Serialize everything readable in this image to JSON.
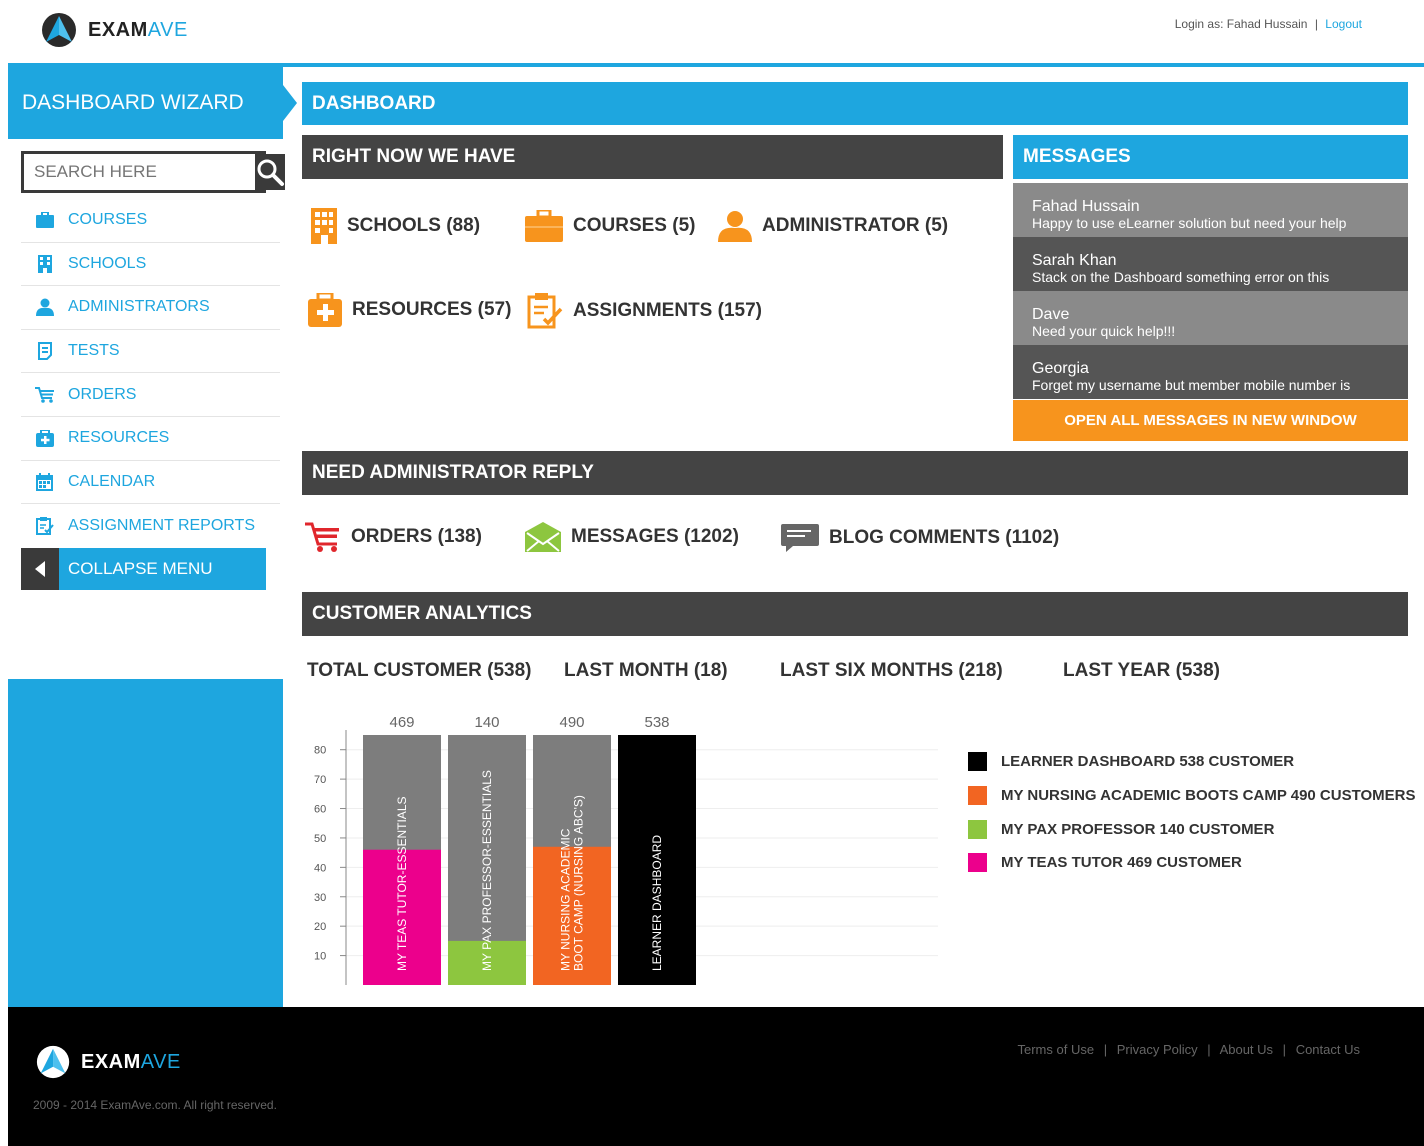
{
  "brand": {
    "name_bold": "EXAM",
    "name_light": "AVE"
  },
  "header": {
    "login_prefix": "Login as: Fahad Hussain",
    "separator": "|",
    "logout": "Logout"
  },
  "sidebar": {
    "title": "DASHBOARD WIZARD",
    "search_placeholder": "SEARCH HERE",
    "items": [
      {
        "label": "COURSES",
        "icon": "briefcase-icon"
      },
      {
        "label": "SCHOOLS",
        "icon": "building-icon"
      },
      {
        "label": "ADMINISTRATORS",
        "icon": "user-icon"
      },
      {
        "label": "TESTS",
        "icon": "document-icon"
      },
      {
        "label": "ORDERS",
        "icon": "cart-icon"
      },
      {
        "label": "RESOURCES",
        "icon": "medkit-icon"
      },
      {
        "label": "CALENDAR",
        "icon": "calendar-icon"
      },
      {
        "label": "ASSIGNMENT REPORTS",
        "icon": "clipboard-icon"
      }
    ],
    "collapse": "COLLAPSE MENU"
  },
  "dashboard": {
    "title": "DASHBOARD"
  },
  "right_now": {
    "title": "RIGHT NOW WE HAVE",
    "items": [
      {
        "label": "SCHOOLS (88)"
      },
      {
        "label": "COURSES (5)"
      },
      {
        "label": "ADMINISTRATOR (5)"
      },
      {
        "label": "RESOURCES (57)"
      },
      {
        "label": "ASSIGNMENTS (157)"
      }
    ]
  },
  "messages": {
    "title": "MESSAGES",
    "items": [
      {
        "name": "Fahad Hussain",
        "text": "Happy to use eLearner solution but need your help"
      },
      {
        "name": "Sarah Khan",
        "text": "Stack on the Dashboard something error on this"
      },
      {
        "name": "Dave",
        "text": "Need your quick help!!!"
      },
      {
        "name": "Georgia",
        "text": "Forget my username but member mobile number is"
      }
    ],
    "open_all": "OPEN ALL MESSAGES IN NEW WINDOW"
  },
  "admin_reply": {
    "title": "NEED ADMINISTRATOR REPLY",
    "items": [
      {
        "label": "ORDERS (138)"
      },
      {
        "label": "MESSAGES (1202)"
      },
      {
        "label": "BLOG COMMENTS (1102)"
      }
    ]
  },
  "analytics": {
    "title": "CUSTOMER ANALYTICS",
    "totals": [
      "TOTAL CUSTOMER (538)",
      "LAST MONTH (18)",
      "LAST SIX MONTHS (218)",
      "LAST YEAR (538)"
    ]
  },
  "chart_data": {
    "type": "bar",
    "ylim": [
      0,
      85
    ],
    "yticks": [
      10,
      20,
      30,
      40,
      50,
      60,
      70,
      80
    ],
    "bars": [
      {
        "top_label": "469",
        "label_lines": [
          "MY TEAS TUTOR-ESSENTIALS"
        ],
        "fill": 46,
        "color": "#ec008c"
      },
      {
        "top_label": "140",
        "label_lines": [
          "MY PAX PROFESSOR-ESSENTIALS"
        ],
        "fill": 15,
        "color": "#8dc63f"
      },
      {
        "top_label": "490",
        "label_lines": [
          "MY NURSING ACADEMIC",
          "BOOT CAMP (NURSING ABC'S)"
        ],
        "fill": 47,
        "color": "#f26522"
      },
      {
        "top_label": "538",
        "label_lines": [
          "LEARNER DASHBOARD"
        ],
        "fill": 85,
        "color": "#000000"
      }
    ],
    "legend": [
      {
        "label": "LEARNER DASHBOARD 538 CUSTOMER",
        "color": "#000000"
      },
      {
        "label": "MY NURSING ACADEMIC BOOTS CAMP 490 CUSTOMERS",
        "color": "#f26522"
      },
      {
        "label": "MY PAX PROFESSOR 140 CUSTOMER",
        "color": "#8dc63f"
      },
      {
        "label": "MY TEAS TUTOR 469 CUSTOMER",
        "color": "#ec008c"
      }
    ]
  },
  "footer": {
    "copyright": "2009 - 2014 ExamAve.com. All right reserved.",
    "links": [
      "Terms of Use",
      "Privacy Policy",
      "About Us",
      "Contact Us"
    ],
    "separator": "|"
  },
  "colors": {
    "accent": "#1ea6df",
    "orange": "#f7941d",
    "dark": "#444444"
  }
}
